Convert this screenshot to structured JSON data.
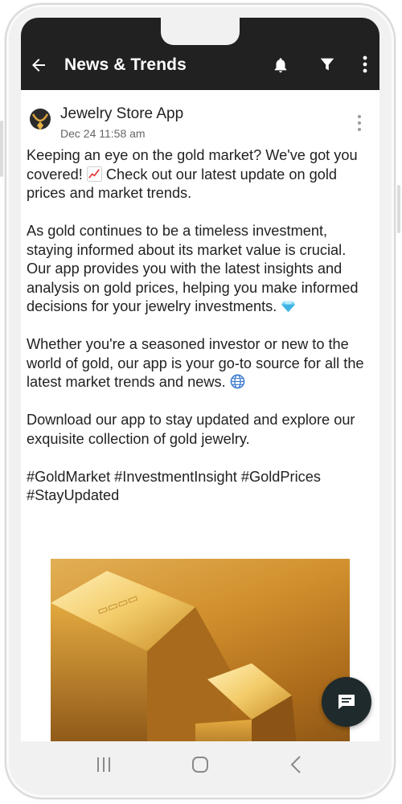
{
  "app_bar": {
    "title": "News & Trends",
    "icons": [
      "back-arrow-icon",
      "bell-icon",
      "filter-icon",
      "more-vertical-icon"
    ],
    "background": "#212121"
  },
  "post": {
    "author": "Jewelry Store App",
    "timestamp": "Dec 24 11:58 am",
    "avatar_icon": "gold-necklace-icon",
    "paragraphs": [
      {
        "text": "Keeping an eye on the gold market? We've got you covered! ",
        "emoji": "chart-increasing-icon",
        "after": " Check out our latest update on gold prices and market trends."
      },
      {
        "text": "As gold continues to be a timeless investment, staying informed about its market value is crucial. Our app provides you with the latest insights and analysis on gold prices, helping you make informed decisions for your jewelry investments. ",
        "emoji": "gem-stone-icon",
        "after": ""
      },
      {
        "text": "Whether you're a seasoned investor or new to the world of gold, our app is your go-to source for all the latest market trends and news. ",
        "emoji": "globe-icon",
        "after": ""
      },
      {
        "text": "Download our app to stay updated and explore our exquisite collection of gold jewelry.",
        "emoji": "",
        "after": ""
      },
      {
        "text": "#GoldMarket #InvestmentInsight #GoldPrices #StayUpdated",
        "emoji": "",
        "after": ""
      }
    ],
    "image": "gold-bars-image"
  },
  "fab_icon": "chat-message-icon",
  "system_nav": [
    "recent-apps-icon",
    "home-icon",
    "nav-back-icon"
  ]
}
